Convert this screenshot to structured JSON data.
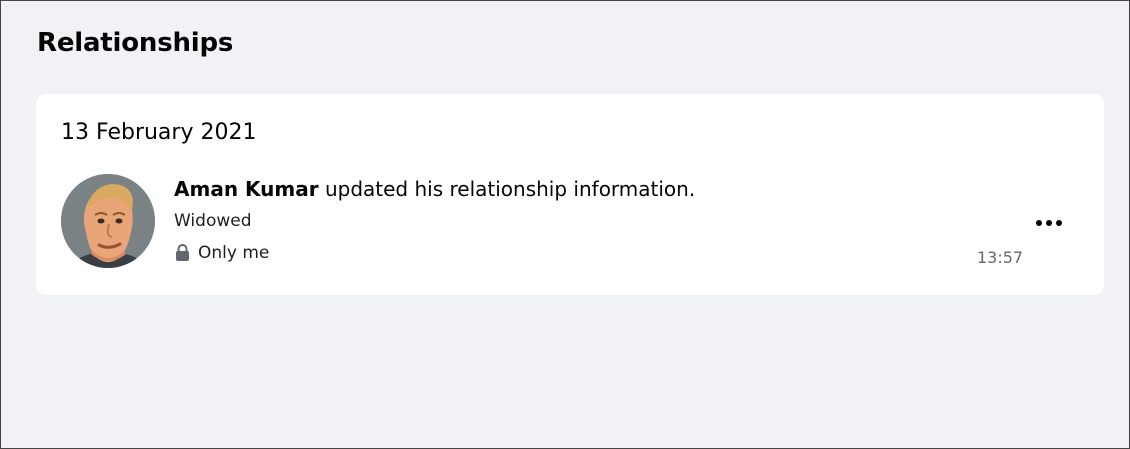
{
  "page": {
    "title": "Relationships"
  },
  "activity": {
    "date": "13 February 2021",
    "actor": "Aman Kumar",
    "action": " updated his relationship information.",
    "status": "Widowed",
    "privacy": "Only me",
    "time": "13:57"
  },
  "icons": {
    "privacy_icon": "lock-icon",
    "more_icon": "more-horizontal-icon",
    "avatar": "avatar"
  },
  "colors": {
    "background": "#f0f2f5",
    "card": "#ffffff",
    "secondary_text": "#65676b"
  }
}
